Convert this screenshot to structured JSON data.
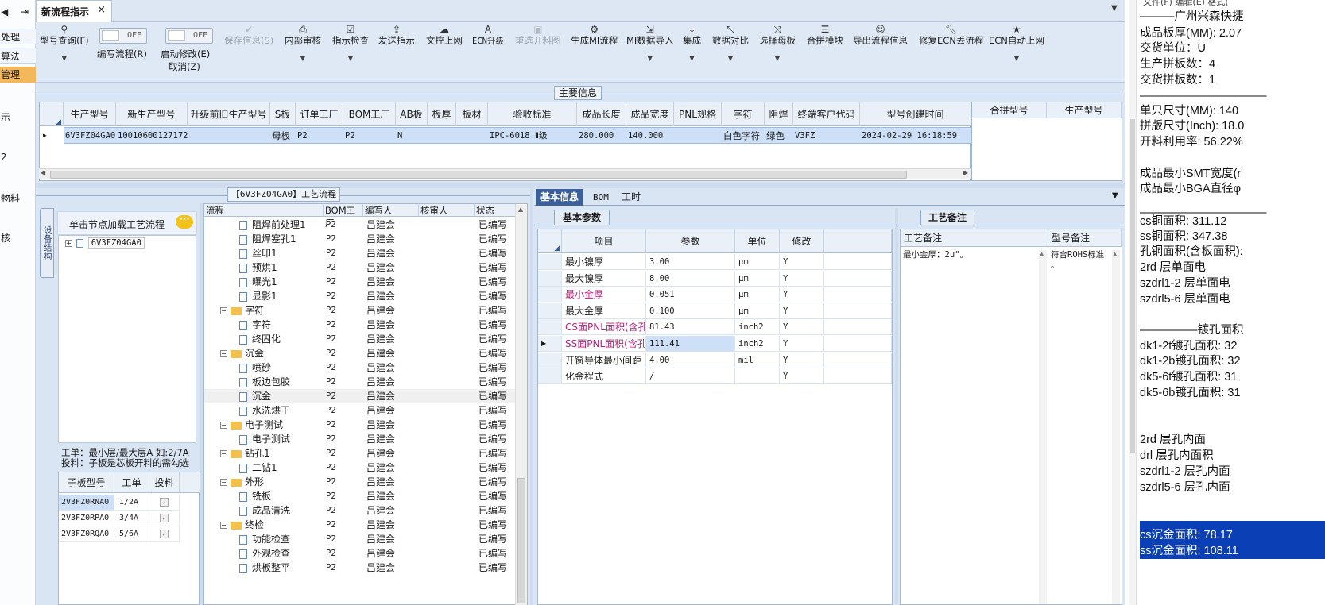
{
  "left_strip": {
    "items": [
      "处理",
      "算法",
      "管理",
      "示",
      "2",
      "物料",
      "核"
    ]
  },
  "tab": {
    "title": "新流程指示",
    "close": "×"
  },
  "toolbar": {
    "model_query": "型号查询(F)",
    "edit_flow": "编写流程(R)",
    "auto_modify": "启动修改(E)",
    "cancel": "取消(Z)",
    "toggle_off": "OFF",
    "save_info": "保存信息(S)",
    "internal_review": "内部审核",
    "instr_check": "指示检查",
    "send_instr": "发送指示",
    "doc_upload": "文控上网",
    "ecn_upgrade": "ECN升级",
    "reselect_cut": "重选开料图",
    "gen_mi_flow": "生成MI流程",
    "mi_import": "MI数据导入",
    "integrate": "集成",
    "data_compare": "数据对比",
    "select_master": "选择母板",
    "combine_module": "合拼模块",
    "export_flow": "导出流程信息",
    "fix_ecn_flow": "修复ECN丢流程",
    "ecn_auto_upload": "ECN自动上网"
  },
  "main_info": {
    "title": "主要信息",
    "headers": [
      "生产型号",
      "新生产型号",
      "升级前旧生产型号",
      "S板",
      "订单工厂",
      "BOM工厂",
      "AB板",
      "板厚",
      "板材",
      "验收标准",
      "成品长度",
      "成品宽度",
      "PNL规格",
      "字符",
      "阻焊",
      "终端客户代码",
      "型号创建时间"
    ],
    "row": [
      "6V3FZ04GA0",
      "10010600127172",
      "",
      "母板",
      "P2",
      "P2",
      "N",
      "",
      "",
      "IPC-6018 Ⅱ级",
      "280.000",
      "140.000",
      "",
      "白色字符",
      "绿色",
      "V3FZ",
      "2024-02-29 16:18:59"
    ],
    "combine_headers": [
      "合拼型号",
      "生产型号"
    ]
  },
  "process": {
    "title": "【6V3FZ04GA0】工艺流程",
    "side_tab": "设备结构",
    "load_hint": "单击节点加载工艺流程",
    "tree_root": "6V3FZ04GA0",
    "note_line1": "工单：最小层/最大层A 如:2/7A",
    "note_line2": "投料：子板是芯板开料的需勾选",
    "sub_headers": [
      "子板型号",
      "工单",
      "投料"
    ],
    "sub_rows": [
      {
        "model": "2V3FZ0RNA0",
        "order": "1/2A"
      },
      {
        "model": "2V3FZ0RPA0",
        "order": "3/4A"
      },
      {
        "model": "2V3FZ0RQA0",
        "order": "5/6A"
      }
    ],
    "grid_headers": [
      "流程",
      "BOM工厂",
      "编写人",
      "核审人",
      "状态"
    ],
    "rows": [
      {
        "name": "阻焊前处理1",
        "type": "doc",
        "bom": "P2",
        "writer": "吕建会",
        "status": "已编写"
      },
      {
        "name": "阻焊塞孔1",
        "type": "doc",
        "bom": "P2",
        "writer": "吕建会",
        "status": "已编写"
      },
      {
        "name": "丝印1",
        "type": "doc",
        "bom": "P2",
        "writer": "吕建会",
        "status": "已编写"
      },
      {
        "name": "预烘1",
        "type": "doc",
        "bom": "P2",
        "writer": "吕建会",
        "status": "已编写"
      },
      {
        "name": "曝光1",
        "type": "doc",
        "bom": "P2",
        "writer": "吕建会",
        "status": "已编写"
      },
      {
        "name": "显影1",
        "type": "doc",
        "bom": "P2",
        "writer": "吕建会",
        "status": "已编写"
      },
      {
        "name": "字符",
        "type": "folder",
        "bom": "P2",
        "writer": "吕建会",
        "status": "已编写"
      },
      {
        "name": "字符",
        "type": "doc",
        "bom": "P2",
        "writer": "吕建会",
        "status": "已编写"
      },
      {
        "name": "终固化",
        "type": "doc",
        "bom": "P2",
        "writer": "吕建会",
        "status": "已编写"
      },
      {
        "name": "沉金",
        "type": "folder",
        "bom": "P2",
        "writer": "吕建会",
        "status": "已编写"
      },
      {
        "name": "喷砂",
        "type": "doc",
        "bom": "P2",
        "writer": "吕建会",
        "status": "已编写"
      },
      {
        "name": "板边包胶",
        "type": "doc",
        "bom": "P2",
        "writer": "吕建会",
        "status": "已编写"
      },
      {
        "name": "沉金",
        "type": "doc",
        "bom": "P2",
        "writer": "吕建会",
        "status": "已编写"
      },
      {
        "name": "水洗烘干",
        "type": "doc",
        "bom": "P2",
        "writer": "吕建会",
        "status": "已编写"
      },
      {
        "name": "电子测试",
        "type": "folder",
        "bom": "P2",
        "writer": "吕建会",
        "status": "已编写"
      },
      {
        "name": "电子测试",
        "type": "doc",
        "bom": "P2",
        "writer": "吕建会",
        "status": "已编写"
      },
      {
        "name": "钻孔1",
        "type": "folder",
        "bom": "P2",
        "writer": "吕建会",
        "status": "已编写"
      },
      {
        "name": "二钻1",
        "type": "doc",
        "bom": "P2",
        "writer": "吕建会",
        "status": "已编写"
      },
      {
        "name": "外形",
        "type": "folder",
        "bom": "P2",
        "writer": "吕建会",
        "status": "已编写"
      },
      {
        "name": "铣板",
        "type": "doc",
        "bom": "P2",
        "writer": "吕建会",
        "status": "已编写"
      },
      {
        "name": "成品清洗",
        "type": "doc",
        "bom": "P2",
        "writer": "吕建会",
        "status": "已编写"
      },
      {
        "name": "终检",
        "type": "folder",
        "bom": "P2",
        "writer": "吕建会",
        "status": "已编写"
      },
      {
        "name": "功能检查",
        "type": "doc",
        "bom": "P2",
        "writer": "吕建会",
        "status": "已编写"
      },
      {
        "name": "外观检查",
        "type": "doc",
        "bom": "P2",
        "writer": "吕建会",
        "status": "已编写"
      },
      {
        "name": "烘板整平",
        "type": "doc",
        "bom": "P2",
        "writer": "吕建会",
        "status": "已编写"
      }
    ]
  },
  "right_tabs": [
    "基本信息",
    "BOM",
    "工时"
  ],
  "basic_params": {
    "title": "基本参数",
    "headers": [
      "项目",
      "参数",
      "单位",
      "修改"
    ],
    "rows": [
      {
        "item": "最小镍厚",
        "value": "3.00",
        "unit": "μm",
        "mod": "Y"
      },
      {
        "item": "最大镍厚",
        "value": "8.00",
        "unit": "μm",
        "mod": "Y"
      },
      {
        "item": "最小金厚",
        "value": "0.051",
        "unit": "μm",
        "mod": "Y"
      },
      {
        "item": "最大金厚",
        "value": "0.100",
        "unit": "μm",
        "mod": "Y"
      },
      {
        "item": "CS面PNL面积(含孔)",
        "value": "81.43",
        "unit": "inch2",
        "mod": "Y"
      },
      {
        "item": "SS面PNL面积(含孔)",
        "value": "111.41",
        "unit": "inch2",
        "mod": "Y"
      },
      {
        "item": "开窗导体最小间距",
        "value": "4.00",
        "unit": "mil",
        "mod": "Y"
      },
      {
        "item": "化金程式",
        "value": "/",
        "unit": "",
        "mod": "Y"
      }
    ]
  },
  "remarks": {
    "title": "工艺备注",
    "headers": [
      "工艺备注",
      "型号备注"
    ],
    "process_remark": "最小金厚：2u\"。",
    "model_remark_1": "符合ROHS标准",
    "model_remark_2": "。"
  },
  "right_pane": {
    "menu": "文件(F)    编辑(E)    格式(",
    "lines": [
      "———广州兴森快捷",
      "成品板厚(MM): 2.07",
      "交货单位：U",
      "生产拼板数：4",
      "交货拼板数：1",
      "———————————",
      "单只尺寸(MM): 140",
      "拼版尺寸(Inch): 18.0",
      "开料利用率: 56.22%",
      "",
      "成品最小SMT宽度(r",
      "成品最小BGA直径φ",
      "———————————",
      "cs铜面积: 311.12",
      "ss铜面积: 347.38",
      "孔铜面积(含板面积):",
      "2rd          层单面电",
      "szdrl1-2     层单面电",
      "szdrl5-6     层单面电",
      "",
      "—————镀孔面积",
      "dk1-2t镀孔面积: 32",
      "dk1-2b镀孔面积: 32",
      "dk5-6t镀孔面积: 31",
      "dk5-6b镀孔面积: 31",
      "",
      "",
      "2rd          层孔内面",
      "drl          层孔内面积",
      "szdrl1-2     层孔内面",
      "szdrl5-6     层孔内面"
    ],
    "highlight_1": "cs沉金面积: 78.17",
    "highlight_2": "ss沉金面积: 108.11"
  }
}
